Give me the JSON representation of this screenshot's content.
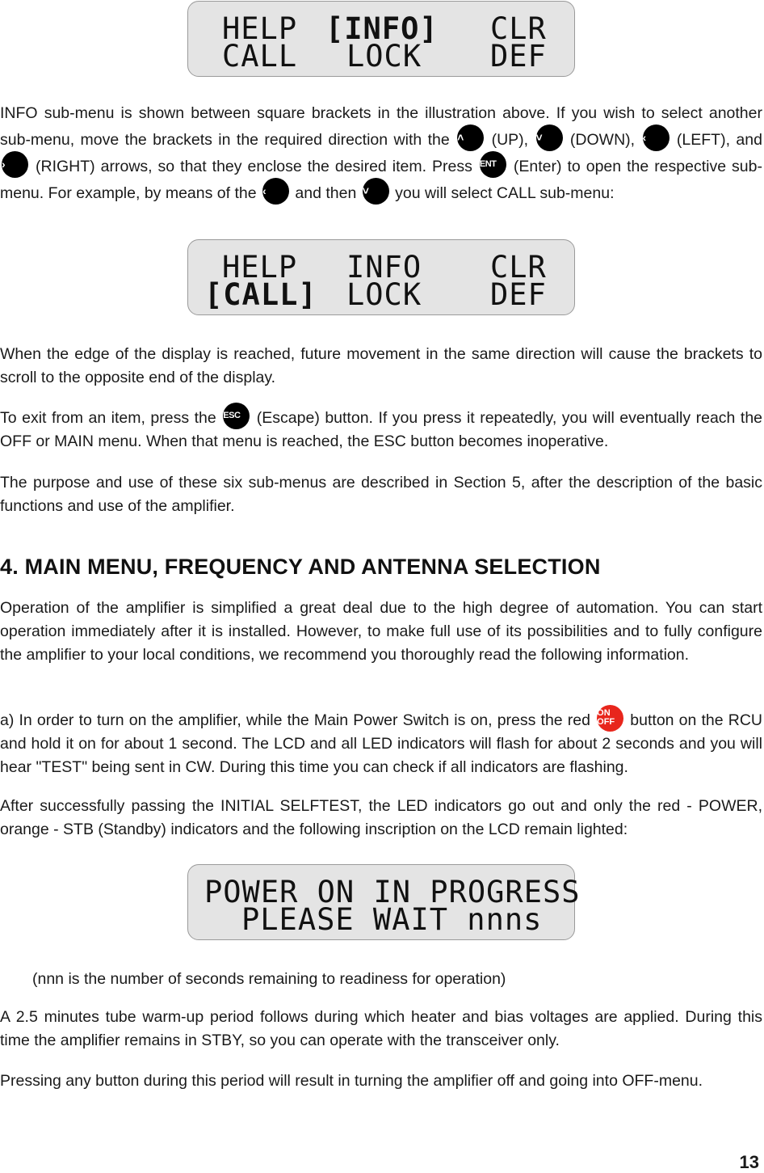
{
  "lcd_displays": [
    {
      "name": "menu-info-selected",
      "row1": [
        "HELP",
        "[INFO]",
        "CLR"
      ],
      "row2": [
        "CALL",
        "LOCK",
        "DEF"
      ],
      "selected": "INFO"
    },
    {
      "name": "menu-call-selected",
      "row1": [
        "HELP",
        "INFO",
        "CLR"
      ],
      "row2": [
        "[CALL]",
        "LOCK",
        "DEF"
      ],
      "selected": "CALL"
    },
    {
      "name": "power-on-progress",
      "row1": "POWER ON IN PROGRESS",
      "row2": "PLEASE WAIT nnns"
    }
  ],
  "keys": {
    "up": "˄",
    "down": "˅",
    "left": "‹",
    "right": "›",
    "ent": "ENT",
    "esc": "ESC",
    "on": "ON",
    "off": "OFF"
  },
  "paragraphs": {
    "p1_a": "INFO sub-menu is shown between square brackets in the illustration above. If you wish to select another sub-menu, move the brackets in the required direction with the",
    "p1_b": "(UP),",
    "p1_c": "(DOWN),",
    "p1_d": "(LEFT), and",
    "p1_e": "(RIGHT) arrows, so that they enclose the desired item. Press",
    "p1_f": "(Enter) to open the respective sub-menu. For example, by means of the",
    "p1_g": "and then",
    "p1_h": "you will select CALL sub-menu:",
    "p2": "When the edge of the display is reached, future movement in the same direction will cause the brackets to scroll to the opposite end of the display.",
    "p3_a": "To exit from an item, press the",
    "p3_b": "(Escape) button. If you press it repeatedly, you will eventually reach the OFF or MAIN menu. When that menu is reached, the ESC button becomes inoperative.",
    "p4": "The purpose and use of these six sub-menus are described in Section 5, after the description of the basic functions and use of the amplifier.",
    "heading": "4. MAIN MENU, FREQUENCY AND ANTENNA SELECTION",
    "p5": "Operation of the amplifier is simplified a great deal due to the high degree of automation. You can start operation immediately after it is installed. However, to make full use of its possibilities and to fully configure the amplifier to your local conditions, we recommend you thoroughly read the following information.",
    "p6_a": "a) In order to turn on the amplifier, while the Main Power Switch is on, press the red",
    "p6_b": "button on the RCU and hold it on for about 1 second. The LCD and all LED indicators will flash for about 2 seconds and you will hear \"TEST\" being sent in CW. During this time you can check if all indicators are flashing.",
    "p7": "After successfully passing the  INITIAL SELFTEST, the LED indicators go out and only the red - POWER, orange - STB (Standby) indicators and the following inscription on the LCD remain lighted:",
    "p8": "(nnn is the number of seconds remaining to readiness for operation)",
    "p9": "A 2.5 minutes tube warm-up period follows during which heater and bias voltages are applied. During this time the amplifier remains in STBY, so you can operate with the transceiver only.",
    "p10": "Pressing any button during this period will result in turning the amplifier off and going into OFF-menu."
  },
  "page_number": "13",
  "colors": {
    "lcd_background": "#e4e4e4",
    "key_black": "#000000",
    "on_off_red": "#e8261c"
  }
}
